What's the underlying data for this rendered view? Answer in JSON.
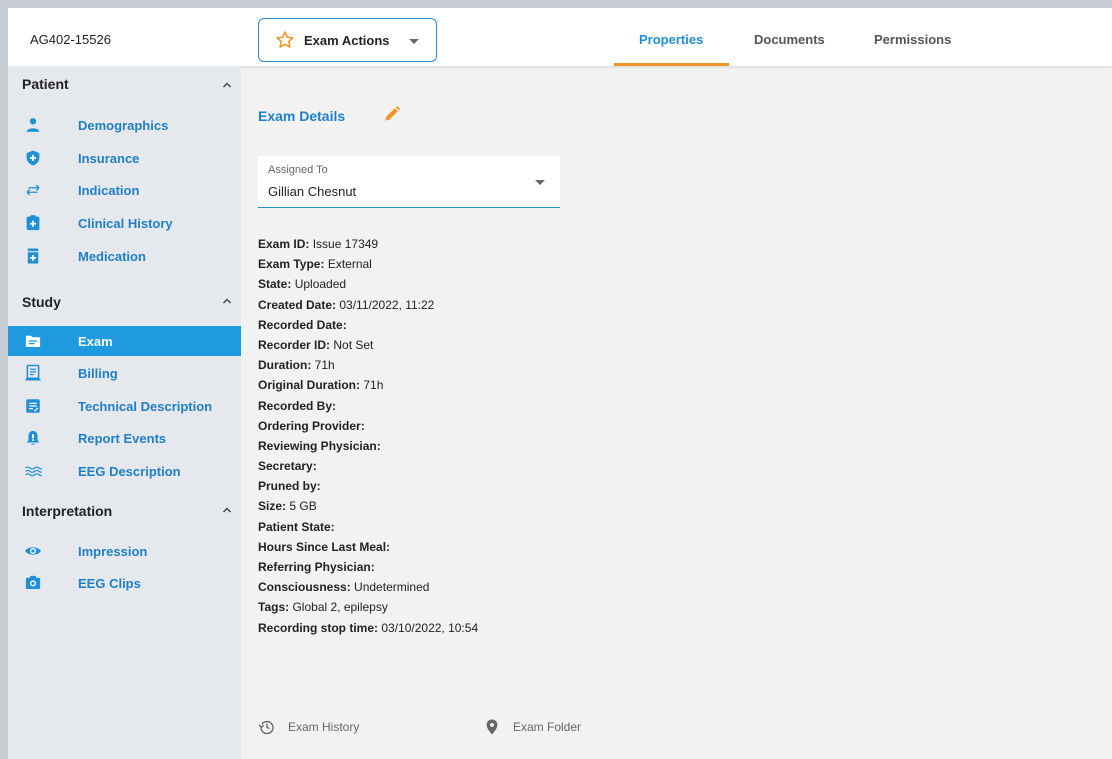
{
  "header": {
    "exam_code": "AG402-15526",
    "actions_label": "Exam Actions",
    "tabs": [
      {
        "label": "Properties",
        "active": true
      },
      {
        "label": "Documents",
        "active": false
      },
      {
        "label": "Permissions",
        "active": false
      }
    ]
  },
  "sidebar": {
    "sections": [
      {
        "title": "Patient",
        "items": [
          {
            "label": "Demographics",
            "icon": "person-icon"
          },
          {
            "label": "Insurance",
            "icon": "shield-plus-icon"
          },
          {
            "label": "Indication",
            "icon": "swap-arrows-icon"
          },
          {
            "label": "Clinical History",
            "icon": "medical-clipboard-icon"
          },
          {
            "label": "Medication",
            "icon": "medication-icon"
          }
        ]
      },
      {
        "title": "Study",
        "items": [
          {
            "label": "Exam",
            "icon": "folder-icon",
            "active": true
          },
          {
            "label": "Billing",
            "icon": "receipt-icon"
          },
          {
            "label": "Technical Description",
            "icon": "document-edit-icon"
          },
          {
            "label": "Report Events",
            "icon": "bell-icon"
          },
          {
            "label": "EEG Description",
            "icon": "waves-icon"
          }
        ]
      },
      {
        "title": "Interpretation",
        "items": [
          {
            "label": "Impression",
            "icon": "eye-icon"
          },
          {
            "label": "EEG Clips",
            "icon": "camera-icon"
          }
        ]
      }
    ]
  },
  "main": {
    "section_title": "Exam Details",
    "assigned": {
      "label": "Assigned To",
      "value": "Gillian Chesnut"
    },
    "fields": [
      {
        "key": "Exam ID:",
        "value": "Issue 17349"
      },
      {
        "key": "Exam Type:",
        "value": "External"
      },
      {
        "key": "State:",
        "value": "Uploaded"
      },
      {
        "key": "Created Date:",
        "value": "03/11/2022, 11:22"
      },
      {
        "key": "Recorded Date:",
        "value": ""
      },
      {
        "key": "Recorder ID:",
        "value": "Not Set"
      },
      {
        "key": "Duration:",
        "value": "71h"
      },
      {
        "key": "Original Duration:",
        "value": "71h"
      },
      {
        "key": "Recorded By:",
        "value": ""
      },
      {
        "key": "Ordering Provider:",
        "value": ""
      },
      {
        "key": "Reviewing Physician:",
        "value": ""
      },
      {
        "key": "Secretary:",
        "value": ""
      },
      {
        "key": "Pruned by:",
        "value": ""
      },
      {
        "key": "Size:",
        "value": "5 GB"
      },
      {
        "key": "Patient State:",
        "value": ""
      },
      {
        "key": "Hours Since Last Meal:",
        "value": ""
      },
      {
        "key": "Referring Physician:",
        "value": ""
      },
      {
        "key": "Consciousness:",
        "value": "Undetermined"
      },
      {
        "key": "Tags:",
        "value": "Global 2, epilepsy"
      },
      {
        "key": "Recording stop time:",
        "value": "03/10/2022, 10:54"
      }
    ],
    "footer": {
      "history_label": "Exam History",
      "folder_label": "Exam Folder"
    }
  },
  "colors": {
    "accent_blue": "#1f8fd6",
    "accent_orange": "#f39323",
    "sidebar_bg": "#e5e8ec",
    "active_item_bg": "#1f9ae0"
  }
}
